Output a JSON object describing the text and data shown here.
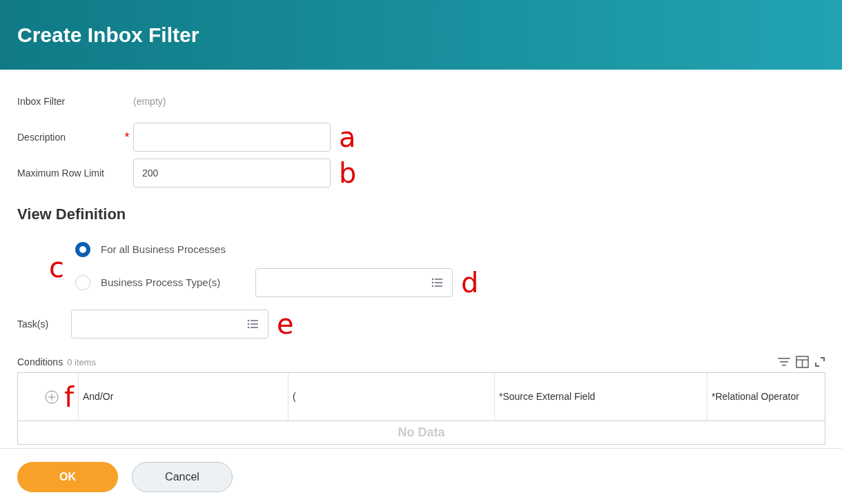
{
  "title": "Create Inbox Filter",
  "fields": [
    {
      "label": "Inbox Filter",
      "kind": "static",
      "value": "(empty)"
    },
    {
      "label": "Description",
      "kind": "input",
      "required_mark": "*",
      "annotation": "a"
    },
    {
      "label": "Maximum Row Limit",
      "kind": "input",
      "value": "200",
      "annotation": "b"
    }
  ],
  "section_title": "View Definition",
  "radio_annotation": "c",
  "radios": [
    {
      "label": "For all Business Processes",
      "selected": true
    },
    {
      "label": "Business Process Type(s)",
      "selected": false,
      "annotation": "d"
    }
  ],
  "task": {
    "label": "Task(s)",
    "annotation": "e"
  },
  "conditions": {
    "title": "Conditions",
    "count": "0 items",
    "add_annotation": "f",
    "columns": [
      "And/Or",
      "(",
      "*Source External Field",
      "*Relational Operator"
    ],
    "empty_text": "No Data"
  },
  "buttons": [
    {
      "label": "OK",
      "kind": "primary"
    },
    {
      "label": "Cancel",
      "kind": "secondary"
    }
  ]
}
